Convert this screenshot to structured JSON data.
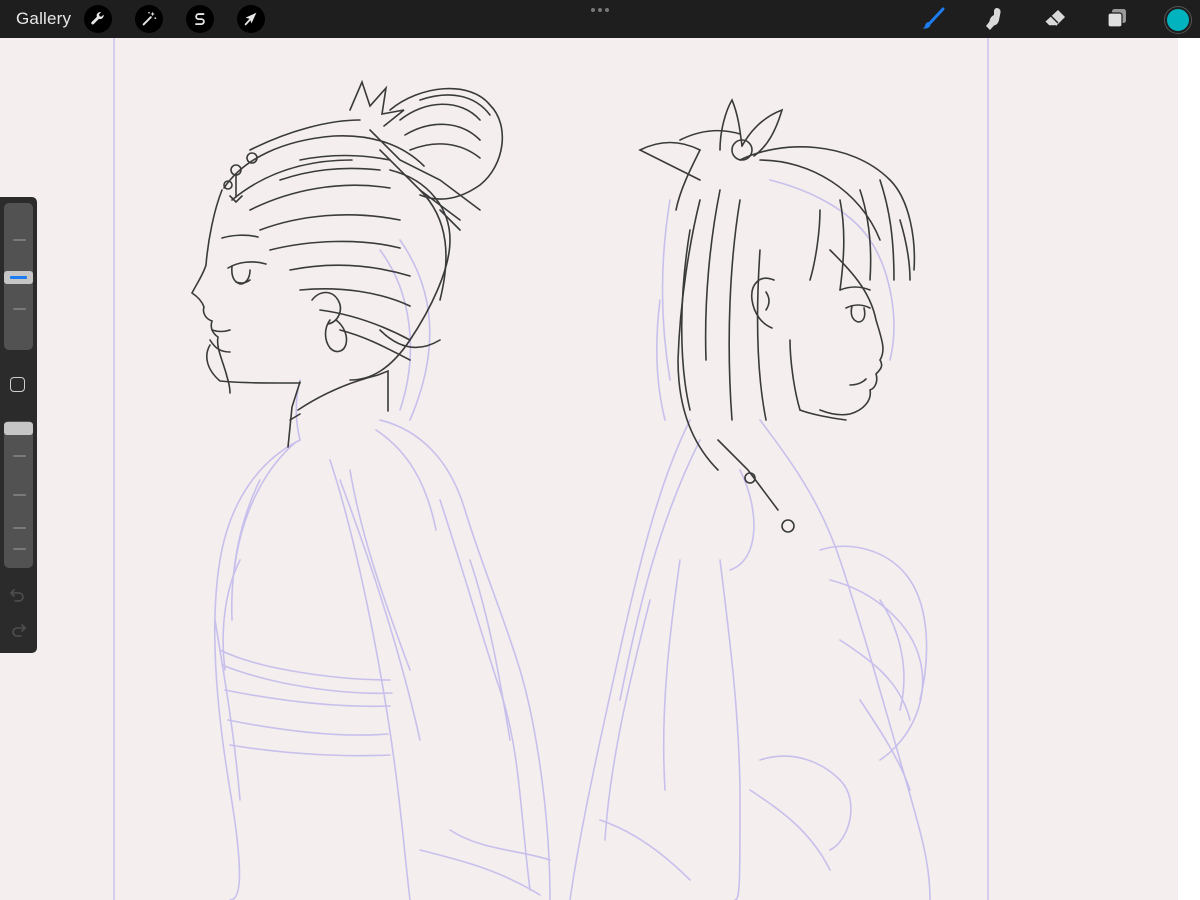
{
  "toolbar": {
    "gallery_label": "Gallery",
    "left_tools": [
      {
        "name": "actions",
        "icon": "wrench-icon"
      },
      {
        "name": "adjustments",
        "icon": "magic-wand-icon"
      },
      {
        "name": "selection",
        "icon": "selection-s-icon"
      },
      {
        "name": "transform",
        "icon": "arrow-cursor-icon"
      }
    ],
    "right_tools": [
      {
        "name": "brush",
        "icon": "brush-icon",
        "active": true
      },
      {
        "name": "smudge",
        "icon": "smudge-finger-icon"
      },
      {
        "name": "eraser",
        "icon": "eraser-icon"
      },
      {
        "name": "layers",
        "icon": "layers-icon"
      }
    ],
    "current_color": "#00b3bf",
    "active_tool_color": "#1d7cf2"
  },
  "sidebar": {
    "brush_size_level": 0.55,
    "opacity_level": 0.0
  },
  "canvas": {
    "background": "#f4eeee",
    "sketch_line_color": "#c9c2ea",
    "ink_color": "#3a3a3a"
  }
}
